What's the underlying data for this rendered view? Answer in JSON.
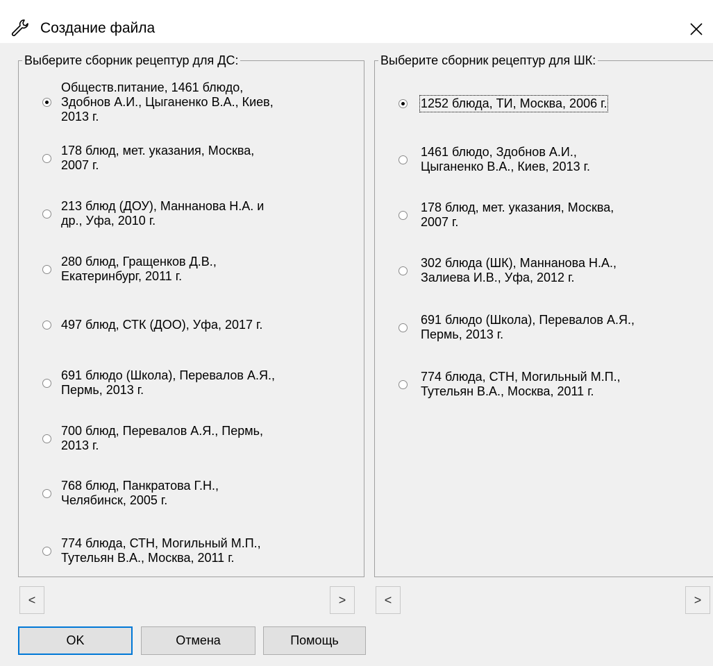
{
  "window": {
    "title": "Создание файла",
    "close_symbol": "✕"
  },
  "left_group": {
    "legend": "Выберите сборник рецептур для ДС:",
    "options": [
      {
        "lines": [
          "Обществ.питание, 1461 блюдо,",
          "Здобнов А.И., Цыганенко В.А., Киев,",
          "2013 г."
        ],
        "checked": true
      },
      {
        "lines": [
          "178 блюд, мет. указания, Москва,",
          "2007 г."
        ],
        "checked": false
      },
      {
        "lines": [
          "213 блюд (ДОУ), Маннанова Н.А. и",
          "др., Уфа, 2010 г."
        ],
        "checked": false
      },
      {
        "lines": [
          "280 блюд, Гращенков Д.В.,",
          "Екатеринбург, 2011 г."
        ],
        "checked": false
      },
      {
        "lines": [
          "497 блюд, СТК (ДОО), Уфа, 2017 г."
        ],
        "checked": false
      },
      {
        "lines": [
          "691 блюдо (Школа), Перевалов А.Я.,",
          "Пермь, 2013 г."
        ],
        "checked": false
      },
      {
        "lines": [
          "700 блюд, Перевалов А.Я., Пермь,",
          "2013 г."
        ],
        "checked": false
      },
      {
        "lines": [
          "768 блюд, Панкратова Г.Н.,",
          "Челябинск, 2005 г."
        ],
        "checked": false
      },
      {
        "lines": [
          "774 блюда, СТН, Могильный М.П.,",
          "Тутельян В.А., Москва, 2011 г."
        ],
        "checked": false
      }
    ]
  },
  "right_group": {
    "legend": "Выберите сборник рецептур для ШК:",
    "options": [
      {
        "lines": [
          "1252 блюда, ТИ, Москва, 2006 г."
        ],
        "checked": true
      },
      {
        "lines": [
          "1461 блюдо, Здобнов А.И.,",
          "Цыганенко В.А., Киев, 2013 г."
        ],
        "checked": false
      },
      {
        "lines": [
          "178 блюд, мет. указания, Москва,",
          "2007 г."
        ],
        "checked": false
      },
      {
        "lines": [
          "302 блюда (ШК), Маннанова Н.А.,",
          "Залиева И.В., Уфа, 2012 г."
        ],
        "checked": false
      },
      {
        "lines": [
          "691 блюдо (Школа), Перевалов А.Я.,",
          "Пермь, 2013 г."
        ],
        "checked": false
      },
      {
        "lines": [
          "774 блюда, СТН, Могильный М.П.,",
          "Тутельян В.А., Москва, 2011 г."
        ],
        "checked": false
      }
    ]
  },
  "scrollbar": {
    "left_arrow": "<",
    "right_arrow": ">"
  },
  "buttons": {
    "ok": "OK",
    "cancel": "Отмена",
    "help": "Помощь"
  }
}
